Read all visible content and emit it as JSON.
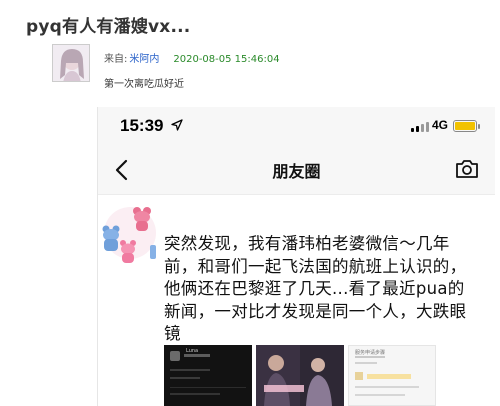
{
  "post": {
    "title": "pyq有人有潘嫂vx...",
    "from_label": "来自:",
    "author": "米阿内",
    "date": "2020-08-05 15:46:04",
    "body": "第一次离吃瓜好近"
  },
  "phone": {
    "status_bar": {
      "time": "15:39",
      "network": "4G",
      "battery_color": "#f2c200"
    },
    "nav": {
      "title": "朋友圈",
      "back_icon": "chevron-left-icon",
      "camera_icon": "camera-icon"
    },
    "moment": {
      "text": "突然发现，我有潘玮柏老婆微信～几年前，和哥们一起飞法国的航班上认识的，他俩还在巴黎逛了几天...看了最近pua的新闻，一对比才发现是同一个人，大跌眼镜",
      "photos": [
        {
          "caption": "Luna"
        },
        {
          "caption": ""
        },
        {
          "caption": "服务申请步骤"
        }
      ]
    }
  },
  "colors": {
    "author_link": "#2a62c9",
    "date": "#2a8a2a"
  }
}
